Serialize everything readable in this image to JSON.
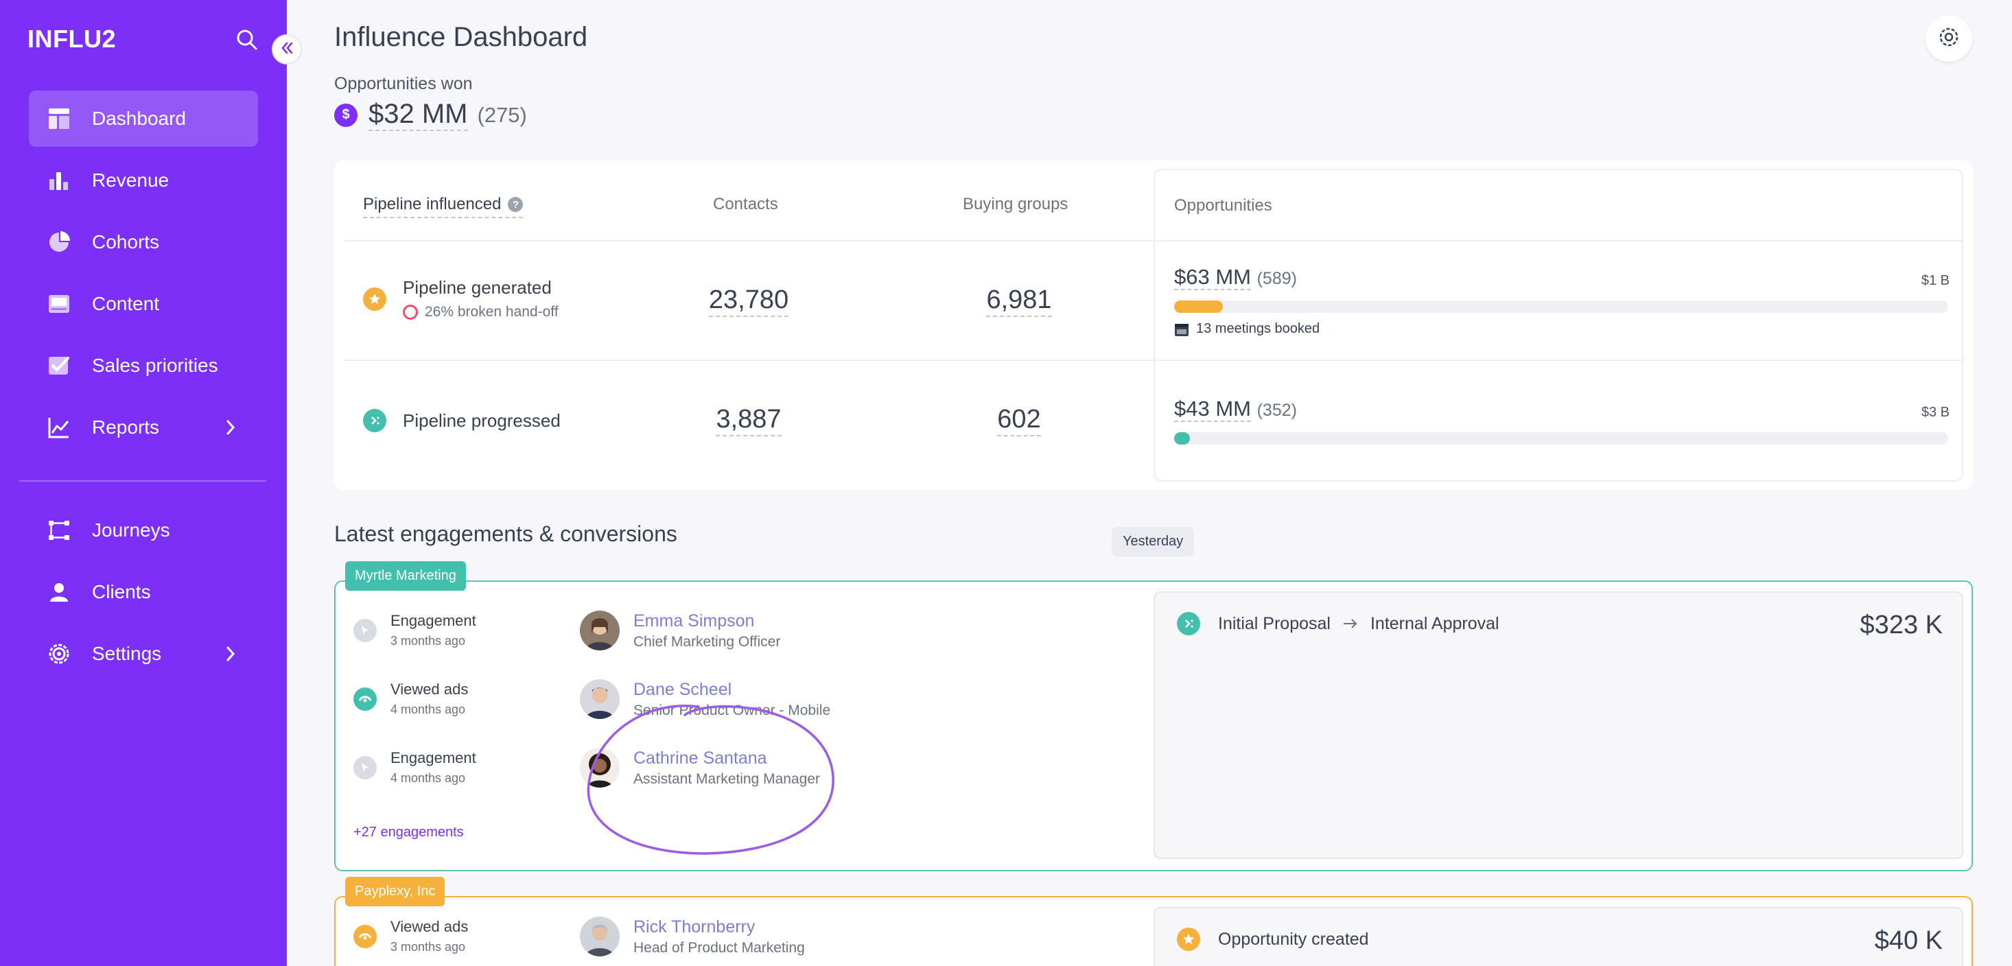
{
  "app": {
    "logo": "INFLU2"
  },
  "sidebar": {
    "items": [
      {
        "label": "Dashboard",
        "icon": "dashboard-icon",
        "active": true
      },
      {
        "label": "Revenue",
        "icon": "bar-chart-icon"
      },
      {
        "label": "Cohorts",
        "icon": "pie-chart-icon"
      },
      {
        "label": "Content",
        "icon": "content-icon"
      },
      {
        "label": "Sales priorities",
        "icon": "checkbox-icon"
      },
      {
        "label": "Reports",
        "icon": "line-chart-icon",
        "has_children": true
      }
    ],
    "items2": [
      {
        "label": "Journeys",
        "icon": "journeys-icon"
      },
      {
        "label": "Clients",
        "icon": "clients-icon"
      },
      {
        "label": "Settings",
        "icon": "settings-icon",
        "has_children": true
      }
    ]
  },
  "header": {
    "title": "Influence Dashboard",
    "opp_won_label": "Opportunities won",
    "opp_won_value": "$32 MM",
    "opp_won_count": "(275)"
  },
  "pipeline": {
    "title": "Pipeline influenced",
    "col_contacts": "Contacts",
    "col_buying_groups": "Buying groups",
    "col_opportunities": "Opportunities",
    "rows": [
      {
        "label": "Pipeline generated",
        "sub": "26% broken hand-off",
        "contacts": "23,780",
        "buying_groups": "6,981",
        "opp_amount": "$63 MM",
        "opp_count": "(589)",
        "opp_max": "$1 B",
        "progress_fraction": 0.063,
        "meetings": "13 meetings booked",
        "color": "#f6b03c"
      },
      {
        "label": "Pipeline progressed",
        "contacts": "3,887",
        "buying_groups": "602",
        "opp_amount": "$43 MM",
        "opp_count": "(352)",
        "opp_max": "$3 B",
        "progress_fraction": 0.014,
        "color": "#43bfae"
      }
    ]
  },
  "engagements": {
    "title": "Latest engagements & conversions",
    "date_chip": "Yesterday",
    "cards": [
      {
        "company": "Myrtle Marketing",
        "company_color": "#43bfae",
        "rows": [
          {
            "type": "Engagement",
            "time": "3 months ago",
            "icon": "cursor-icon"
          },
          {
            "type": "Viewed ads",
            "time": "4 months ago",
            "icon": "eye-icon"
          },
          {
            "type": "Engagement",
            "time": "4 months ago",
            "icon": "cursor-icon"
          }
        ],
        "people": [
          {
            "name": "Emma Simpson",
            "role": "Chief Marketing Officer"
          },
          {
            "name": "Dane Scheel",
            "role": "Senior Product Owner - Mobile"
          },
          {
            "name": "Cathrine Santana",
            "role": "Assistant Marketing Manager"
          }
        ],
        "more": "+27 engagements",
        "conversion": {
          "from": "Initial Proposal",
          "to": "Internal Approval",
          "amount": "$323 K"
        }
      },
      {
        "company": "Payplexy, Inc",
        "company_color": "#f6b03c",
        "rows": [
          {
            "type": "Viewed ads",
            "time": "3 months ago",
            "icon": "eye-icon"
          }
        ],
        "people": [
          {
            "name": "Rick Thornberry",
            "role": "Head of Product Marketing"
          }
        ],
        "conversion": {
          "label": "Opportunity created",
          "amount": "$40 K"
        }
      }
    ]
  }
}
